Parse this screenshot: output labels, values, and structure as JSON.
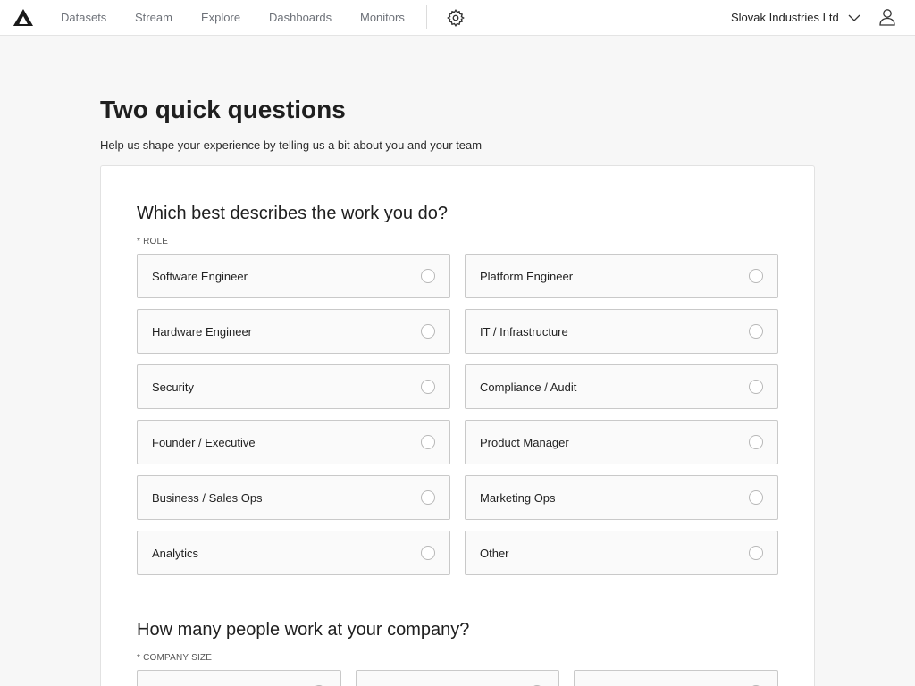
{
  "nav": {
    "links": [
      "Datasets",
      "Stream",
      "Explore",
      "Dashboards",
      "Monitors"
    ],
    "org_name": "Slovak Industries Ltd"
  },
  "page": {
    "title": "Two quick questions",
    "subtitle": "Help us shape your experience by telling us a bit about you and your team"
  },
  "role_question": {
    "title": "Which best describes the work you do?",
    "label": "* ROLE",
    "options": [
      "Software Engineer",
      "Platform Engineer",
      "Hardware Engineer",
      "IT / Infrastructure",
      "Security",
      "Compliance / Audit",
      "Founder / Executive",
      "Product Manager",
      "Business / Sales Ops",
      "Marketing Ops",
      "Analytics",
      "Other"
    ]
  },
  "size_question": {
    "title": "How many people work at your company?",
    "label": "* COMPANY SIZE"
  }
}
